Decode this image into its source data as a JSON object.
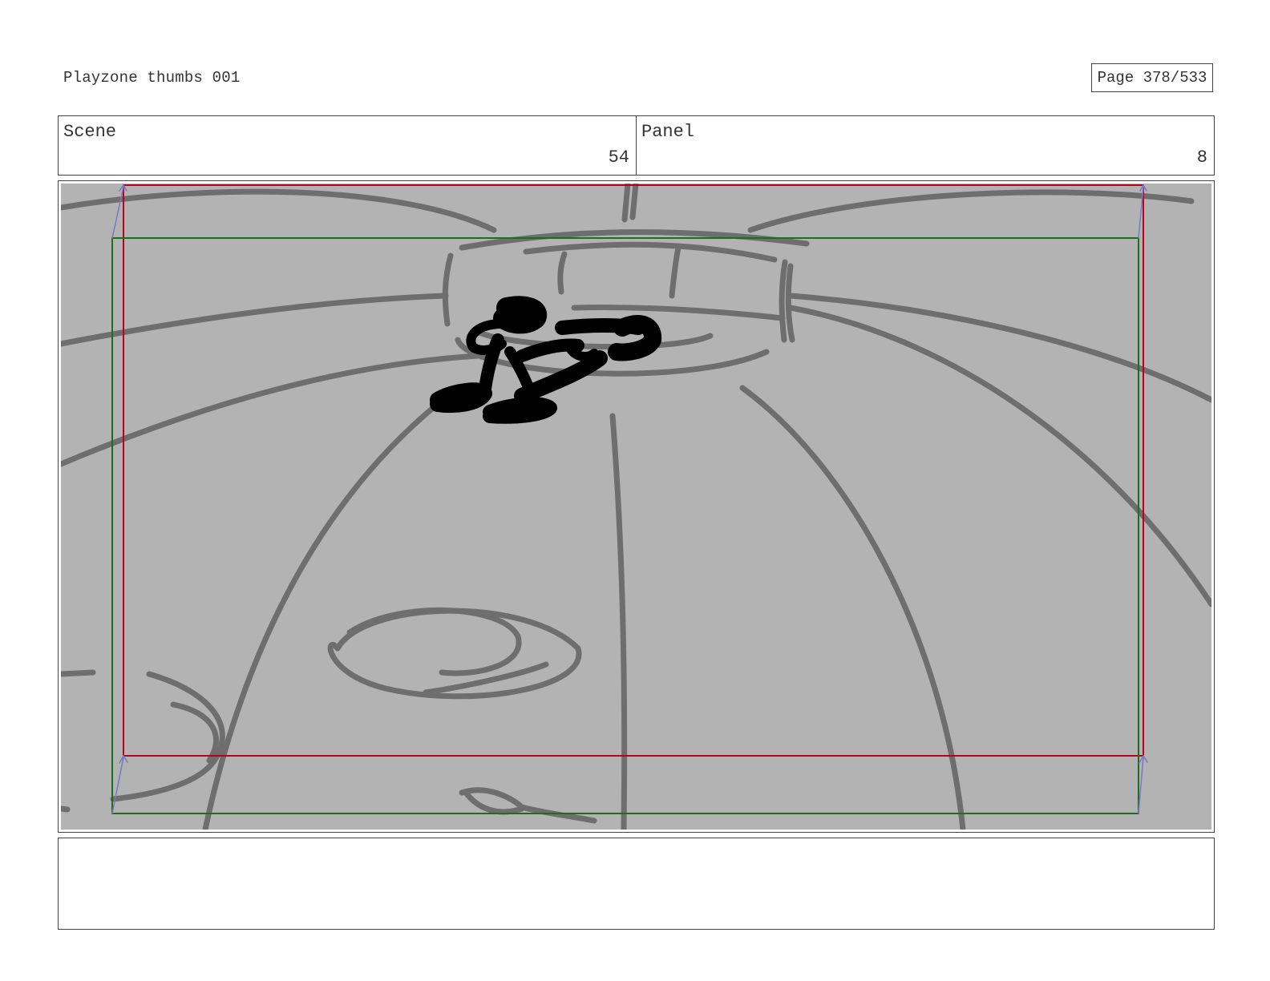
{
  "header": {
    "title": "Playzone thumbs 001",
    "page_label": "Page 378/533"
  },
  "info": {
    "scene_label": "Scene",
    "scene_value": "54",
    "panel_label": "Panel",
    "panel_value": "8"
  },
  "frame": {
    "background_color": "#b3b3b3",
    "sketch_color": "#6e6e6e",
    "figure_color": "#000000",
    "action_safe_color": "#c0001a",
    "title_safe_color": "#1e6e1e",
    "camera_arrow_color": "#7a78c8"
  },
  "notes": {
    "text": ""
  }
}
